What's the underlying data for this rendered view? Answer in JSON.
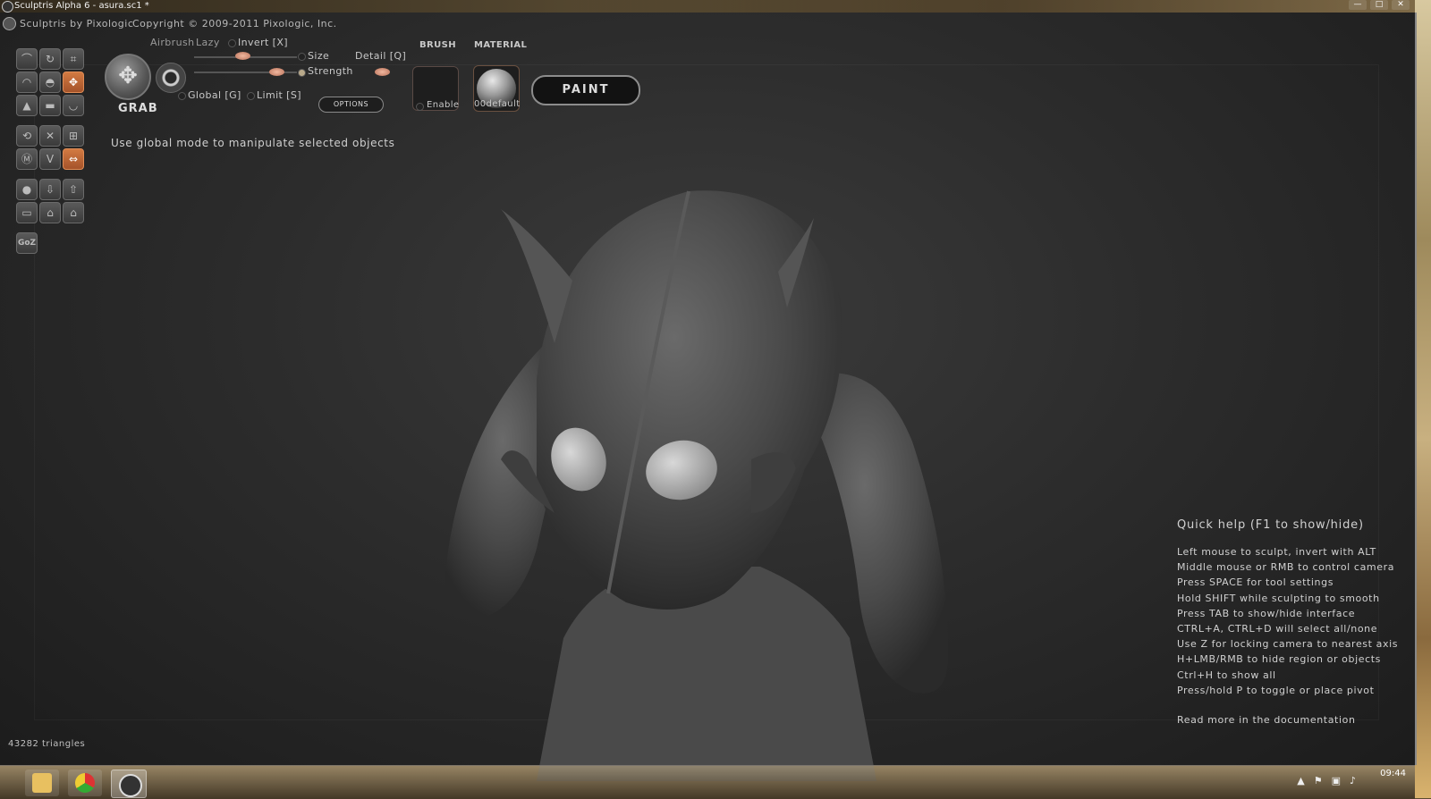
{
  "window": {
    "title": "Sculptris Alpha 6 - asura.sc1 *",
    "controls": [
      "—",
      "□",
      "✕"
    ]
  },
  "header": {
    "brand": "Sculptris by Pixologic",
    "copyright": "Copyright © 2009-2011 Pixologic, Inc."
  },
  "tool": {
    "name": "GRAB",
    "airbrush_label": "Airbrush",
    "lazy_label": "Lazy",
    "invert_label": "Invert [X]",
    "size_label": "Size",
    "detail_label": "Detail [Q]",
    "strength_label": "Strength",
    "global_label": "Global [G]",
    "limit_label": "Limit [S]",
    "options_label": "OPTIONS",
    "brush_label": "BRUSH",
    "brush_enable_label": "Enable",
    "material_label": "MATERIAL",
    "material_name": "00default",
    "paint_label": "PAINT",
    "size_value": 0.47,
    "strength_value": 0.86
  },
  "toolgrid": {
    "icons": [
      "crease-icon",
      "rotate-icon",
      "scale-icon",
      "draw-icon",
      "inflate-icon",
      "grab-icon",
      "pinch-icon",
      "flatten-icon",
      "smooth-icon",
      "symmetry-icon",
      "wireframe-icon",
      "subdivide-icon",
      "reduce-icon",
      "mask-icon",
      "mirror-icon",
      "sphere-icon",
      "import-icon",
      "export-icon",
      "plane-icon",
      "save-icon",
      "open-icon",
      "goz-icon"
    ],
    "goz_label": "GoZ"
  },
  "hint": "Use global mode to manipulate selected objects",
  "quick_help": {
    "title": "Quick help (F1 to show/hide)",
    "lines": [
      "Left mouse to sculpt, invert with ALT",
      "Middle mouse or RMB to control camera",
      "Press SPACE for tool settings",
      "Hold SHIFT while sculpting to smooth",
      "Press TAB to show/hide interface",
      "CTRL+A, CTRL+D will select all/none",
      "Use Z for locking camera to nearest axis",
      "H+LMB/RMB to hide region or objects",
      "Ctrl+H to show all",
      "Press/hold P to toggle or place pivot"
    ],
    "more": "Read more in the documentation"
  },
  "status": {
    "triangles": "43282 triangles"
  },
  "taskbar": {
    "time": "09:44",
    "items": [
      "folder-icon",
      "chrome-icon",
      "sculptris-icon"
    ]
  },
  "colors": {
    "accent": "#d27a42",
    "background": "#2c2c2c"
  }
}
